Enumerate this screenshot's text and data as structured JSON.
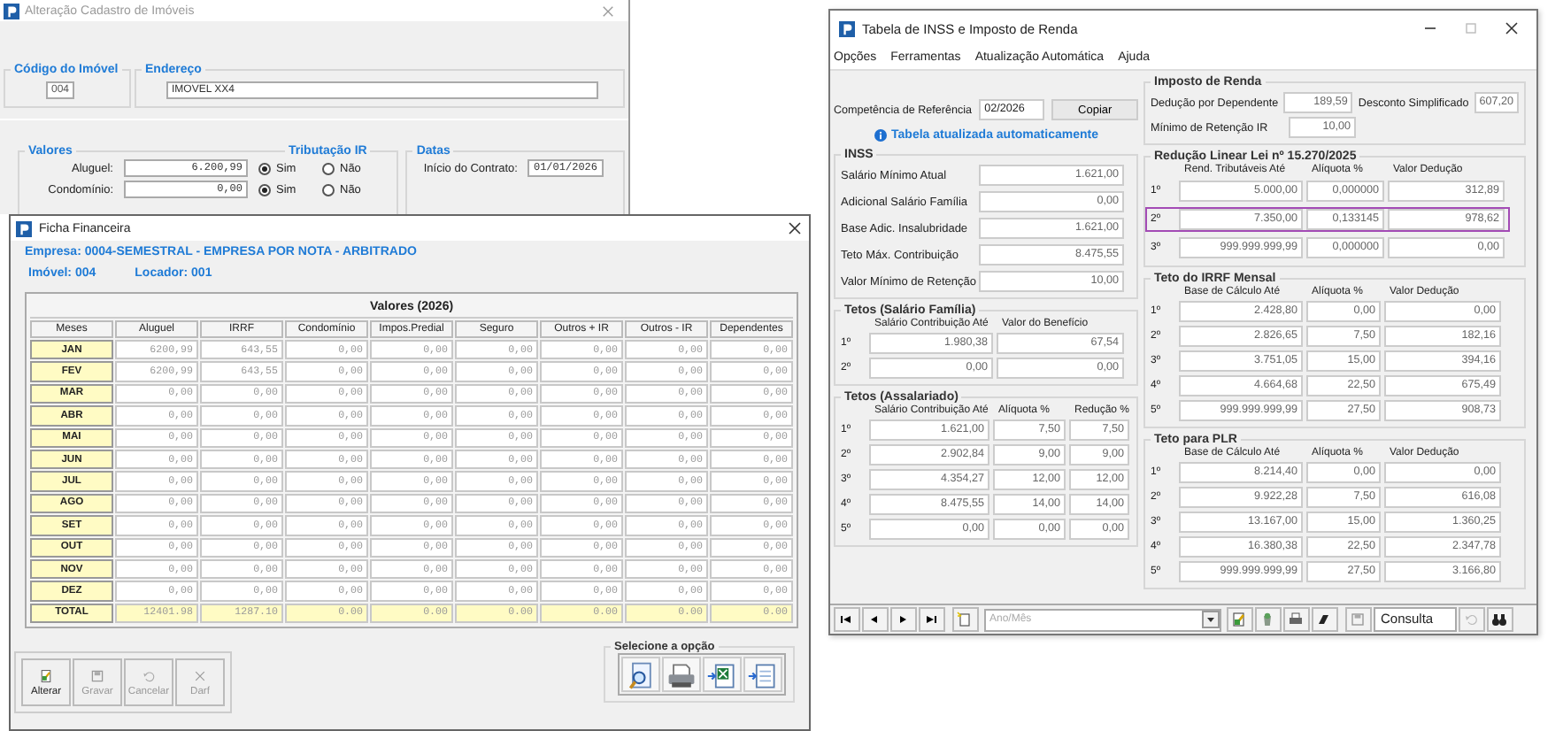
{
  "property_window": {
    "title": "Alteração Cadastro de Imóveis",
    "code": {
      "label": "Código do Imóvel",
      "value": "004"
    },
    "address": {
      "label": "Endereço",
      "value": "IMOVEL XX4"
    },
    "values": {
      "title": "Valores",
      "tax_title": "Tributação IR",
      "rows": [
        {
          "label": "Aluguel:",
          "value": "6.200,99",
          "options": [
            {
              "label": "Sim",
              "selected": true
            },
            {
              "label": "Não",
              "selected": false
            }
          ]
        },
        {
          "label": "Condomínio:",
          "value": "0,00",
          "options": [
            {
              "label": "Sim",
              "selected": true
            },
            {
              "label": "Não",
              "selected": false
            }
          ]
        }
      ]
    },
    "dates": {
      "title": "Datas",
      "start_label": "Início do Contrato:",
      "start_value": "01/01/2026"
    }
  },
  "financial_window": {
    "title": "Ficha Financeira",
    "company": "Empresa: 0004-SEMESTRAL - EMPRESA POR NOTA - ARBITRADO",
    "property": "Imóvel: 004",
    "landlord": "Locador: 001",
    "table": {
      "title": "Valores (2026)",
      "columns": [
        "Meses",
        "Aluguel",
        "IRRF",
        "Condomínio",
        "Impos.Predial",
        "Seguro",
        "Outros + IR",
        "Outros - IR",
        "Dependentes"
      ],
      "rows": [
        {
          "cells": [
            "JAN",
            "6200,99",
            "643,55",
            "0,00",
            "0,00",
            "0,00",
            "0,00",
            "0,00",
            "0,00"
          ]
        },
        {
          "cells": [
            "FEV",
            "6200,99",
            "643,55",
            "0,00",
            "0,00",
            "0,00",
            "0,00",
            "0,00",
            "0,00"
          ]
        },
        {
          "cells": [
            "MAR",
            "0,00",
            "0,00",
            "0,00",
            "0,00",
            "0,00",
            "0,00",
            "0,00",
            "0,00"
          ]
        },
        {
          "cells": [
            "ABR",
            "0,00",
            "0,00",
            "0,00",
            "0,00",
            "0,00",
            "0,00",
            "0,00",
            "0,00"
          ]
        },
        {
          "cells": [
            "MAI",
            "0,00",
            "0,00",
            "0,00",
            "0,00",
            "0,00",
            "0,00",
            "0,00",
            "0,00"
          ]
        },
        {
          "cells": [
            "JUN",
            "0,00",
            "0,00",
            "0,00",
            "0,00",
            "0,00",
            "0,00",
            "0,00",
            "0,00"
          ]
        },
        {
          "cells": [
            "JUL",
            "0,00",
            "0,00",
            "0,00",
            "0,00",
            "0,00",
            "0,00",
            "0,00",
            "0,00"
          ]
        },
        {
          "cells": [
            "AGO",
            "0,00",
            "0,00",
            "0,00",
            "0,00",
            "0,00",
            "0,00",
            "0,00",
            "0,00"
          ]
        },
        {
          "cells": [
            "SET",
            "0,00",
            "0,00",
            "0,00",
            "0,00",
            "0,00",
            "0,00",
            "0,00",
            "0,00"
          ]
        },
        {
          "cells": [
            "OUT",
            "0,00",
            "0,00",
            "0,00",
            "0,00",
            "0,00",
            "0,00",
            "0,00",
            "0,00"
          ]
        },
        {
          "cells": [
            "NOV",
            "0,00",
            "0,00",
            "0,00",
            "0,00",
            "0,00",
            "0,00",
            "0,00",
            "0,00"
          ]
        },
        {
          "cells": [
            "DEZ",
            "0,00",
            "0,00",
            "0,00",
            "0,00",
            "0,00",
            "0,00",
            "0,00",
            "0,00"
          ]
        }
      ],
      "total": {
        "cells": [
          "TOTAL",
          "12401.98",
          "1287.10",
          "0.00",
          "0.00",
          "0.00",
          "0.00",
          "0.00",
          "0.00"
        ]
      }
    },
    "buttons": [
      {
        "kind": "edit",
        "label": "Alterar",
        "disabled": false
      },
      {
        "kind": "save",
        "label": "Gravar",
        "disabled": true
      },
      {
        "kind": "undo",
        "label": "Cancelar",
        "disabled": true
      },
      {
        "kind": "close",
        "label": "Darf",
        "disabled": true
      }
    ],
    "options_title": "Selecione a opção"
  },
  "tax_window": {
    "title": "Tabela de INSS e Imposto de Renda",
    "menu": [
      "Opções",
      "Ferramentas",
      "Atualização Automática",
      "Ajuda"
    ],
    "reference": {
      "label": "Competência de Referência",
      "value": "02/2026"
    },
    "copy_button": "Copiar",
    "info": "Tabela atualizada automaticamente",
    "inss": {
      "title": "INSS",
      "rows": [
        {
          "label": "Salário Mínimo Atual",
          "value": "1.621,00"
        },
        {
          "label": "Adicional Salário Família",
          "value": "0,00"
        },
        {
          "label": "Base Adic. Insalubridade",
          "value": "1.621,00"
        },
        {
          "label": "Teto Máx. Contribuição",
          "value": "8.475,55"
        },
        {
          "label": "Valor Mínimo de Retenção",
          "value": "10,00"
        }
      ]
    },
    "family": {
      "title": "Tetos (Salário Família)",
      "columns": [
        "Salário Contribuição Até",
        "Valor do Benefício"
      ],
      "rows": [
        {
          "ordinal": "1º",
          "cells": [
            "1.980,38",
            "67,54"
          ]
        },
        {
          "ordinal": "2º",
          "cells": [
            "0,00",
            "0,00"
          ]
        }
      ]
    },
    "salaried": {
      "title": "Tetos (Assalariado)",
      "columns": [
        "Salário Contribuição Até",
        "Alíquota %",
        "Redução %"
      ],
      "rows": [
        {
          "ordinal": "1º",
          "cells": [
            "1.621,00",
            "7,50",
            "7,50"
          ]
        },
        {
          "ordinal": "2º",
          "cells": [
            "2.902,84",
            "9,00",
            "9,00"
          ]
        },
        {
          "ordinal": "3º",
          "cells": [
            "4.354,27",
            "12,00",
            "12,00"
          ]
        },
        {
          "ordinal": "4º",
          "cells": [
            "8.475,55",
            "14,00",
            "14,00"
          ]
        },
        {
          "ordinal": "5º",
          "cells": [
            "0,00",
            "0,00",
            "0,00"
          ]
        }
      ]
    },
    "income_tax": {
      "title": "Imposto de Renda",
      "dependent": {
        "label": "Dedução por Dependente",
        "value": "189,59"
      },
      "simplified": {
        "label": "Desconto Simplificado",
        "value": "607,20"
      },
      "minimum": {
        "label": "Mínimo de Retenção IR",
        "value": "10,00"
      }
    },
    "reduction": {
      "title": "Redução Linear Lei nº 15.270/2025",
      "columns": [
        "Rend. Tributáveis Até",
        "Alíquota %",
        "Valor Dedução"
      ],
      "rows": [
        {
          "ordinal": "1º",
          "cells": [
            "5.000,00",
            "0,000000",
            "312,89"
          ],
          "selected": false
        },
        {
          "ordinal": "2º",
          "cells": [
            "7.350,00",
            "0,133145",
            "978,62"
          ],
          "selected": true
        },
        {
          "ordinal": "3º",
          "cells": [
            "999.999.999,99",
            "0,000000",
            "0,00"
          ],
          "selected": false
        }
      ]
    },
    "irrf": {
      "title": "Teto do IRRF Mensal",
      "columns": [
        "Base de Cálculo Até",
        "Alíquota %",
        "Valor Dedução"
      ],
      "rows": [
        {
          "ordinal": "1º",
          "cells": [
            "2.428,80",
            "0,00",
            "0,00"
          ]
        },
        {
          "ordinal": "2º",
          "cells": [
            "2.826,65",
            "7,50",
            "182,16"
          ]
        },
        {
          "ordinal": "3º",
          "cells": [
            "3.751,05",
            "15,00",
            "394,16"
          ]
        },
        {
          "ordinal": "4º",
          "cells": [
            "4.664,68",
            "22,50",
            "675,49"
          ]
        },
        {
          "ordinal": "5º",
          "cells": [
            "999.999.999,99",
            "27,50",
            "908,73"
          ]
        }
      ]
    },
    "plr": {
      "title": "Teto para PLR",
      "columns": [
        "Base de Cálculo Até",
        "Alíquota %",
        "Valor Dedução"
      ],
      "rows": [
        {
          "ordinal": "1º",
          "cells": [
            "8.214,40",
            "0,00",
            "0,00"
          ]
        },
        {
          "ordinal": "2º",
          "cells": [
            "9.922,28",
            "7,50",
            "616,08"
          ]
        },
        {
          "ordinal": "3º",
          "cells": [
            "13.167,00",
            "15,00",
            "1.360,25"
          ]
        },
        {
          "ordinal": "4º",
          "cells": [
            "16.380,38",
            "22,50",
            "2.347,78"
          ]
        },
        {
          "ordinal": "5º",
          "cells": [
            "999.999.999,99",
            "27,50",
            "3.166,80"
          ]
        }
      ]
    },
    "toolbar": {
      "period_placeholder": "Ano/Mês",
      "mode": "Consulta"
    }
  }
}
